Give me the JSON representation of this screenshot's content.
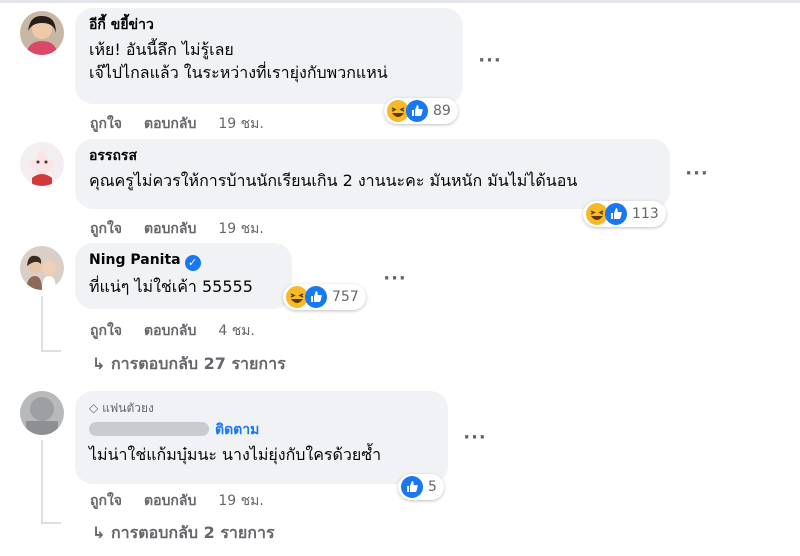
{
  "comments": [
    {
      "name": "อีกี้ ขยี้ข่าว",
      "lines": [
        "เห้ย! อันนี้ลึก ไม่รู้เลย",
        "เจ๊ไปไกลแล้ว ในระหว่างที่เรายุ่งกับพวกแหน่"
      ],
      "reactions": {
        "icons": [
          "haha",
          "like"
        ],
        "count": "89"
      },
      "actions": {
        "like": "ถูกใจ",
        "reply": "ตอบกลับ",
        "time": "19 ชม."
      }
    },
    {
      "name": "อรรถรส",
      "lines": [
        "คุณครูไม่ควรให้การบ้านนักเรียนเกิน 2 งานนะคะ มันหนัก มันไม่ได้นอน"
      ],
      "reactions": {
        "icons": [
          "haha",
          "like"
        ],
        "count": "113"
      },
      "actions": {
        "like": "ถูกใจ",
        "reply": "ตอบกลับ",
        "time": "19 ชม."
      }
    },
    {
      "name": "Ning Panita",
      "verified": true,
      "lines": [
        "ที่แน่ๆ ไม่ใช่เค้า 55555"
      ],
      "reactions": {
        "icons": [
          "haha",
          "like"
        ],
        "count": "757"
      },
      "actions": {
        "like": "ถูกใจ",
        "reply": "ตอบกลับ",
        "time": "4 ชม."
      },
      "replies_link": "การตอบกลับ 27 รายการ"
    },
    {
      "badge": "แฟนตัวยง",
      "follow": "ติดตาม",
      "lines": [
        "ไม่น่าใช่แก้มบุ๋มนะ นางไม่ยุ่งกับใครด้วยซ้ำ"
      ],
      "reactions": {
        "icons": [
          "like"
        ],
        "count": "5"
      },
      "actions": {
        "like": "ถูกใจ",
        "reply": "ตอบกลับ",
        "time": "19 ชม."
      },
      "replies_link": "การตอบกลับ 2 รายการ"
    }
  ],
  "more_label": "···",
  "reply_arrow": "↳",
  "colors": {
    "bubble": "#f0f2f5",
    "like": "#1877f2",
    "haha": "#f7b928",
    "muted": "#65676b",
    "link": "#1877f2"
  }
}
